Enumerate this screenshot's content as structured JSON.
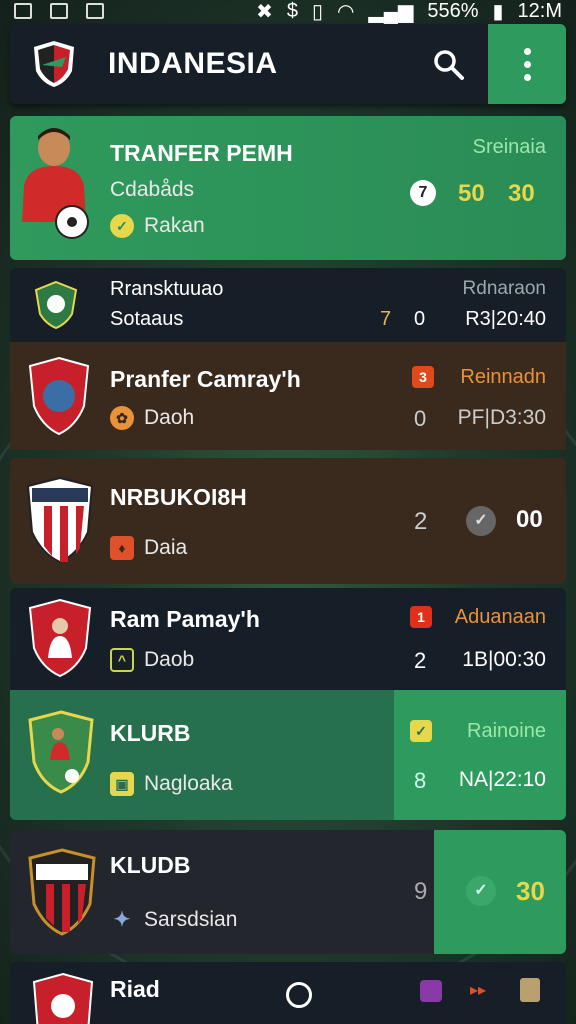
{
  "status_bar": {
    "battery": "556%",
    "time": "12:M"
  },
  "app_bar": {
    "title": "INDANESIA"
  },
  "featured": {
    "title": "TRANFER PEMH",
    "subtitle": "Cdabåds",
    "tag": "Rakan",
    "status": "Sreinaia",
    "score_a": "7",
    "score_b": "50",
    "score_c": "30"
  },
  "row1": {
    "line1": "Rransktuuao",
    "line2": "Sotaaus",
    "num": "7",
    "arrow": "0",
    "status": "Rdnaraon",
    "time": "R3|20:40"
  },
  "row2": {
    "title": "Pranfer Camray'h",
    "tag": "Daoh",
    "badge": "3",
    "status": "Reinnadn",
    "num": "0",
    "time": "PF|D3:30"
  },
  "row3": {
    "title": "NRBUKOI8H",
    "tag": "Daia",
    "num": "2",
    "score": "00"
  },
  "row4": {
    "title": "Ram Pamay'h",
    "tag": "Daob",
    "badge": "1",
    "status": "Aduanaan",
    "num": "2",
    "time": "1B|00:30"
  },
  "row5": {
    "title": "KLURB",
    "tag": "Nagloaka",
    "status": "Rainoine",
    "num": "8",
    "time": "NA|22:10"
  },
  "row6": {
    "title": "KLUDB",
    "tag": "Sarsdsian",
    "num": "9",
    "score": "30"
  },
  "row7": {
    "title": "Riad"
  },
  "colors": {
    "green": "#2e9b5e",
    "dark": "#161e27",
    "brown": "#3a2a1e",
    "accent_orange": "#e8923a",
    "accent_yellow": "#e6d84a"
  }
}
